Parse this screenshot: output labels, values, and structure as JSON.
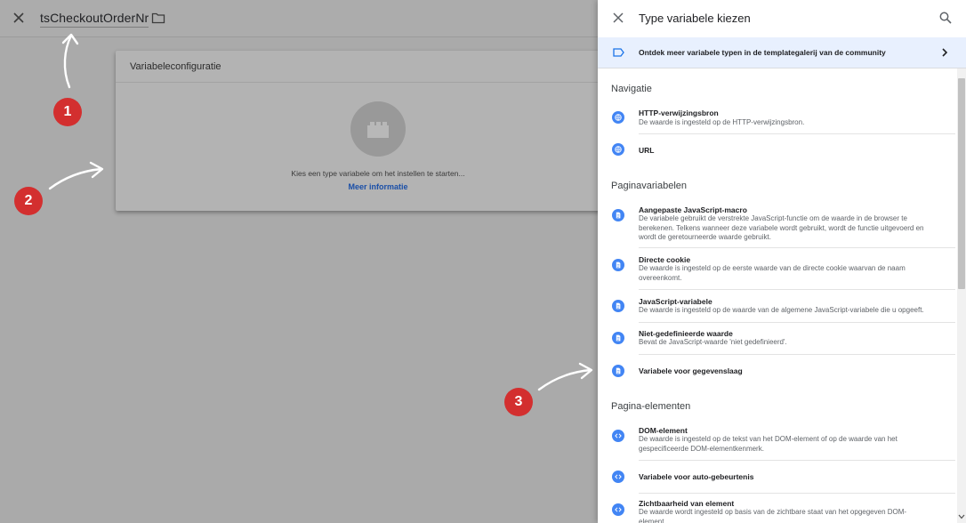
{
  "left": {
    "variable_name": "tsCheckoutOrderNr",
    "card_title": "Variabeleconfiguratie",
    "card_text": "Kies een type variabele om het instellen te starten...",
    "card_link": "Meer informatie"
  },
  "badges": [
    "1",
    "2",
    "3"
  ],
  "panel": {
    "title": "Type variabele kiezen",
    "banner_text": "Ontdek meer variabele typen in de templategalerij van de community",
    "sections": [
      {
        "header": "Navigatie"
      },
      {
        "header": "Paginavariabelen"
      },
      {
        "header": "Pagina-elementen"
      }
    ],
    "items": [
      {
        "title": "HTTP-verwijzingsbron",
        "desc": "De waarde is ingesteld op de HTTP-verwijzingsbron.",
        "icon": "globe-icon"
      },
      {
        "title": "URL",
        "desc": "",
        "icon": "globe-icon"
      },
      {
        "title": "Aangepaste JavaScript-macro",
        "desc": "De variabele gebruikt de verstrekte JavaScript-functie om de waarde in de browser te berekenen. Telkens wanneer deze variabele wordt gebruikt, wordt de functie uitgevoerd en wordt de geretourneerde waarde gebruikt.",
        "icon": "document-icon"
      },
      {
        "title": "Directe cookie",
        "desc": "De waarde is ingesteld op de eerste waarde van de directe cookie waarvan de naam overeenkomt.",
        "icon": "document-icon"
      },
      {
        "title": "JavaScript-variabele",
        "desc": "De waarde is ingesteld op de waarde van de algemene JavaScript-variabele die u opgeeft.",
        "icon": "document-icon"
      },
      {
        "title": "Niet-gedefinieerde waarde",
        "desc": "Bevat de JavaScript-waarde 'niet gedefinieerd'.",
        "icon": "document-icon"
      },
      {
        "title": "Variabele voor gegevenslaag",
        "desc": "",
        "icon": "document-icon"
      },
      {
        "title": "DOM-element",
        "desc": "De waarde is ingesteld op de tekst van het DOM-element of op de waarde van het gespecificeerde DOM-elementkenmerk.",
        "icon": "code-icon"
      },
      {
        "title": "Variabele voor auto-gebeurtenis",
        "desc": "",
        "icon": "code-icon"
      },
      {
        "title": "Zichtbaarheid van element",
        "desc": "De waarde wordt ingesteld op basis van de zichtbare staat van het opgegeven DOM-element.",
        "icon": "code-icon"
      }
    ]
  },
  "colors": {
    "accent_blue": "#4285f4",
    "link_blue": "#1a4fa8",
    "badge_red": "#d32f2f",
    "overlay_gray": "#aaaaaa",
    "banner_bg": "#e8f0fe"
  }
}
